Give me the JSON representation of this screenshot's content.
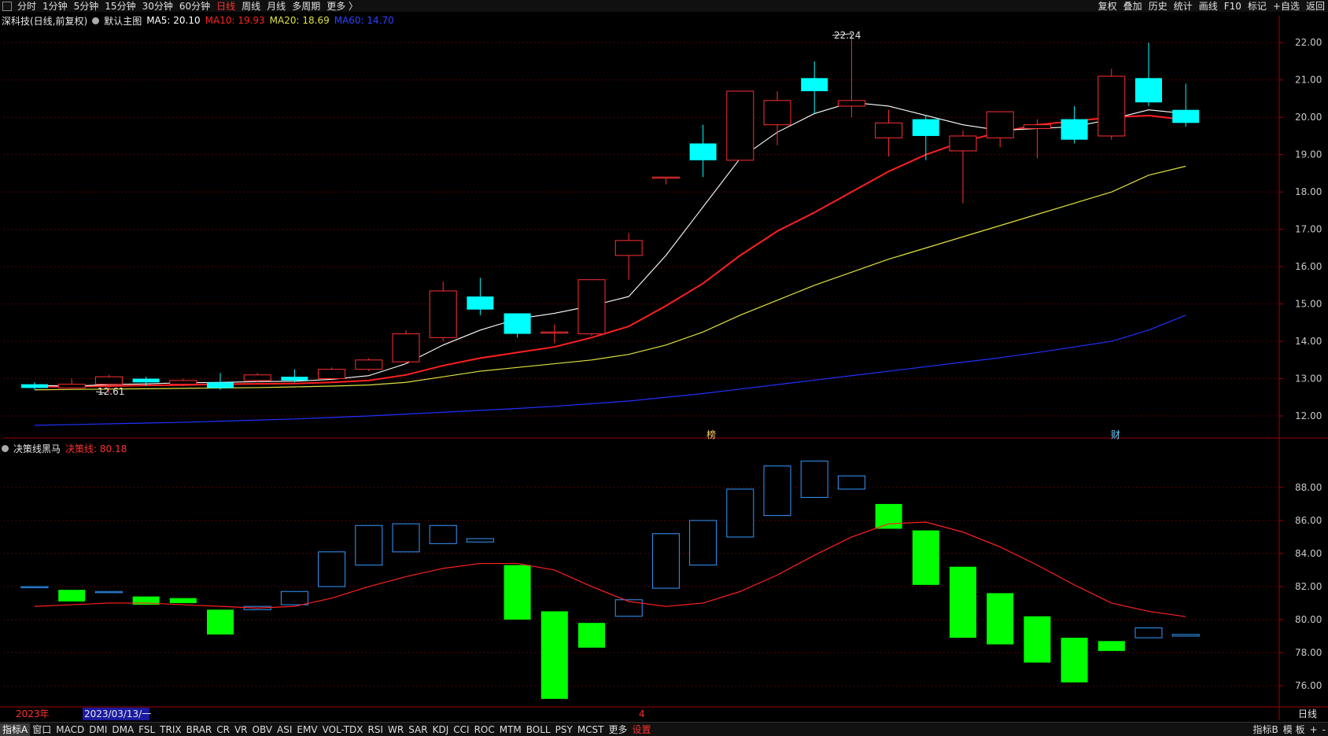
{
  "toolbar": {
    "periods": [
      "分时",
      "1分钟",
      "5分钟",
      "15分钟",
      "30分钟",
      "60分钟",
      "日线",
      "周线",
      "月线",
      "多周期",
      "更多 〉"
    ],
    "active_period": "日线",
    "right_buttons": [
      "复权",
      "叠加",
      "历史",
      "统计",
      "画线",
      "F10",
      "标记",
      "+自选",
      "返回"
    ]
  },
  "main_header": {
    "stock": "深科技(日线,前复权)",
    "template": "默认主图",
    "ma5": "MA5: 20.10",
    "ma10": "MA10: 19.93",
    "ma20": "MA20: 18.69",
    "ma60": "MA60: 14.70"
  },
  "sub_header": {
    "indicator": "决策线黑马",
    "line": "决策线: 80.18"
  },
  "colors": {
    "up": "#ff3030",
    "down": "#00ffff",
    "ma5": "#ffffff",
    "ma10": "#ff2020",
    "ma20": "#e0e040",
    "ma60": "#2030ff",
    "sub_up": "#3399ff",
    "sub_down": "#00ff00",
    "grid": "#5a0000"
  },
  "annotations": {
    "high": "22.24",
    "low": "12.61",
    "tag1": "榜",
    "tag2": "财"
  },
  "axis": {
    "price_ticks": [
      "22.00",
      "21.00",
      "20.00",
      "19.00",
      "18.00",
      "17.00",
      "16.00",
      "15.00",
      "14.00",
      "13.00",
      "12.00"
    ],
    "sub_ticks": [
      "88.00",
      "86.00",
      "84.00",
      "82.00",
      "80.00",
      "78.00",
      "76.00"
    ],
    "date_left": "2023年",
    "date_cursor": "2023/03/13/一",
    "date_mark": "4",
    "period_label": "日线"
  },
  "chart_data": {
    "type": "candlestick",
    "price_range": [
      11.6,
      22.3
    ],
    "candles": [
      {
        "o": 12.85,
        "c": 12.75,
        "h": 12.9,
        "l": 12.7
      },
      {
        "o": 12.75,
        "c": 12.85,
        "h": 13.0,
        "l": 12.7
      },
      {
        "o": 12.85,
        "c": 13.05,
        "h": 13.1,
        "l": 12.6
      },
      {
        "o": 13.0,
        "c": 12.9,
        "h": 13.05,
        "l": 12.8
      },
      {
        "o": 12.85,
        "c": 12.95,
        "h": 13.0,
        "l": 12.8
      },
      {
        "o": 12.9,
        "c": 12.75,
        "h": 13.15,
        "l": 12.7
      },
      {
        "o": 12.95,
        "c": 13.1,
        "h": 13.15,
        "l": 12.9
      },
      {
        "o": 13.05,
        "c": 12.95,
        "h": 13.25,
        "l": 12.9
      },
      {
        "o": 13.0,
        "c": 13.25,
        "h": 13.3,
        "l": 12.95
      },
      {
        "o": 13.25,
        "c": 13.5,
        "h": 13.55,
        "l": 13.2
      },
      {
        "o": 13.45,
        "c": 14.2,
        "h": 14.3,
        "l": 13.4
      },
      {
        "o": 14.1,
        "c": 15.35,
        "h": 15.6,
        "l": 14.0
      },
      {
        "o": 15.2,
        "c": 14.85,
        "h": 15.7,
        "l": 14.7
      },
      {
        "o": 14.75,
        "c": 14.2,
        "h": 14.75,
        "l": 14.1
      },
      {
        "o": 14.25,
        "c": 14.25,
        "h": 14.45,
        "l": 13.95
      },
      {
        "o": 14.2,
        "c": 15.65,
        "h": 15.65,
        "l": 14.15
      },
      {
        "o": 16.3,
        "c": 16.7,
        "h": 16.9,
        "l": 15.65
      },
      {
        "o": 18.4,
        "c": 18.4,
        "h": 18.4,
        "l": 18.2
      },
      {
        "o": 19.3,
        "c": 18.85,
        "h": 19.8,
        "l": 18.4
      },
      {
        "o": 18.85,
        "c": 20.7,
        "h": 20.7,
        "l": 18.85
      },
      {
        "o": 19.8,
        "c": 20.45,
        "h": 20.7,
        "l": 19.25
      },
      {
        "o": 21.05,
        "c": 20.7,
        "h": 21.5,
        "l": 20.1
      },
      {
        "o": 20.3,
        "c": 20.45,
        "h": 22.24,
        "l": 20.0
      },
      {
        "o": 19.45,
        "c": 19.85,
        "h": 20.2,
        "l": 18.95
      },
      {
        "o": 19.95,
        "c": 19.5,
        "h": 20.05,
        "l": 18.85
      },
      {
        "o": 19.1,
        "c": 19.5,
        "h": 19.65,
        "l": 17.7
      },
      {
        "o": 19.45,
        "c": 20.15,
        "h": 20.15,
        "l": 19.2
      },
      {
        "o": 19.7,
        "c": 19.8,
        "h": 19.95,
        "l": 18.9
      },
      {
        "o": 19.95,
        "c": 19.4,
        "h": 20.3,
        "l": 19.3
      },
      {
        "o": 19.5,
        "c": 21.1,
        "h": 21.3,
        "l": 19.4
      },
      {
        "o": 21.05,
        "c": 20.4,
        "h": 22.0,
        "l": 20.3
      },
      {
        "o": 20.2,
        "c": 19.85,
        "h": 20.9,
        "l": 19.75
      }
    ],
    "ma5": [
      12.82,
      12.8,
      12.84,
      12.86,
      12.89,
      12.9,
      12.92,
      12.93,
      12.98,
      13.08,
      13.4,
      13.9,
      14.3,
      14.6,
      14.75,
      14.95,
      15.2,
      16.3,
      17.6,
      18.9,
      19.6,
      20.1,
      20.4,
      20.3,
      20.05,
      19.8,
      19.65,
      19.7,
      19.75,
      19.95,
      20.2,
      20.1
    ],
    "ma10": [
      12.78,
      12.79,
      12.8,
      12.82,
      12.83,
      12.85,
      12.86,
      12.87,
      12.9,
      12.95,
      13.1,
      13.35,
      13.55,
      13.7,
      13.85,
      14.1,
      14.4,
      14.95,
      15.55,
      16.3,
      16.95,
      17.45,
      18.0,
      18.55,
      19.0,
      19.35,
      19.6,
      19.8,
      19.9,
      20.0,
      20.05,
      19.93
    ],
    "ma20": [
      12.7,
      12.71,
      12.72,
      12.73,
      12.74,
      12.75,
      12.76,
      12.78,
      12.8,
      12.83,
      12.9,
      13.05,
      13.2,
      13.3,
      13.4,
      13.5,
      13.65,
      13.9,
      14.25,
      14.7,
      15.1,
      15.5,
      15.85,
      16.2,
      16.5,
      16.8,
      17.1,
      17.4,
      17.7,
      18.0,
      18.45,
      18.69
    ],
    "ma60": [
      11.75,
      11.77,
      11.79,
      11.81,
      11.83,
      11.86,
      11.89,
      11.92,
      11.96,
      12.0,
      12.05,
      12.1,
      12.15,
      12.2,
      12.26,
      12.33,
      12.4,
      12.5,
      12.6,
      12.72,
      12.84,
      12.96,
      13.08,
      13.2,
      13.32,
      13.44,
      13.56,
      13.7,
      13.85,
      14.0,
      14.3,
      14.7
    ],
    "sub_range": [
      75.0,
      89.9
    ],
    "sub_bars": [
      {
        "o": 82.0,
        "c": 82.0
      },
      {
        "o": 81.8,
        "c": 81.1
      },
      {
        "o": 81.7,
        "c": 81.7
      },
      {
        "o": 81.4,
        "c": 80.9
      },
      {
        "o": 81.3,
        "c": 81.0
      },
      {
        "o": 80.6,
        "c": 79.1
      },
      {
        "o": 80.6,
        "c": 80.8
      },
      {
        "o": 80.9,
        "c": 81.7
      },
      {
        "o": 82.0,
        "c": 84.1
      },
      {
        "o": 83.3,
        "c": 85.7
      },
      {
        "o": 84.1,
        "c": 85.8
      },
      {
        "o": 84.6,
        "c": 85.7
      },
      {
        "o": 84.7,
        "c": 84.9
      },
      {
        "o": 83.3,
        "c": 80.0
      },
      {
        "o": 80.5,
        "c": 75.2
      },
      {
        "o": 79.8,
        "c": 78.3
      },
      {
        "o": 80.2,
        "c": 81.2
      },
      {
        "o": 81.9,
        "c": 85.2
      },
      {
        "o": 83.3,
        "c": 86.0
      },
      {
        "o": 85.0,
        "c": 87.9
      },
      {
        "o": 86.3,
        "c": 89.3
      },
      {
        "o": 87.4,
        "c": 89.6
      },
      {
        "o": 87.9,
        "c": 88.7
      },
      {
        "o": 87.0,
        "c": 85.5
      },
      {
        "o": 85.4,
        "c": 82.1
      },
      {
        "o": 83.2,
        "c": 78.9
      },
      {
        "o": 81.6,
        "c": 78.5
      },
      {
        "o": 80.2,
        "c": 77.4
      },
      {
        "o": 78.9,
        "c": 76.2
      },
      {
        "o": 78.7,
        "c": 78.1
      },
      {
        "o": 78.9,
        "c": 79.5
      },
      {
        "o": 79.0,
        "c": 79.1
      }
    ],
    "decision_line": [
      80.8,
      80.9,
      81.0,
      81.0,
      80.9,
      80.8,
      80.7,
      80.8,
      81.3,
      82.0,
      82.6,
      83.1,
      83.4,
      83.4,
      83.0,
      82.0,
      81.1,
      80.8,
      81.0,
      81.7,
      82.7,
      83.9,
      85.0,
      85.8,
      85.9,
      85.3,
      84.4,
      83.3,
      82.1,
      81.0,
      80.5,
      80.18
    ]
  }
}
